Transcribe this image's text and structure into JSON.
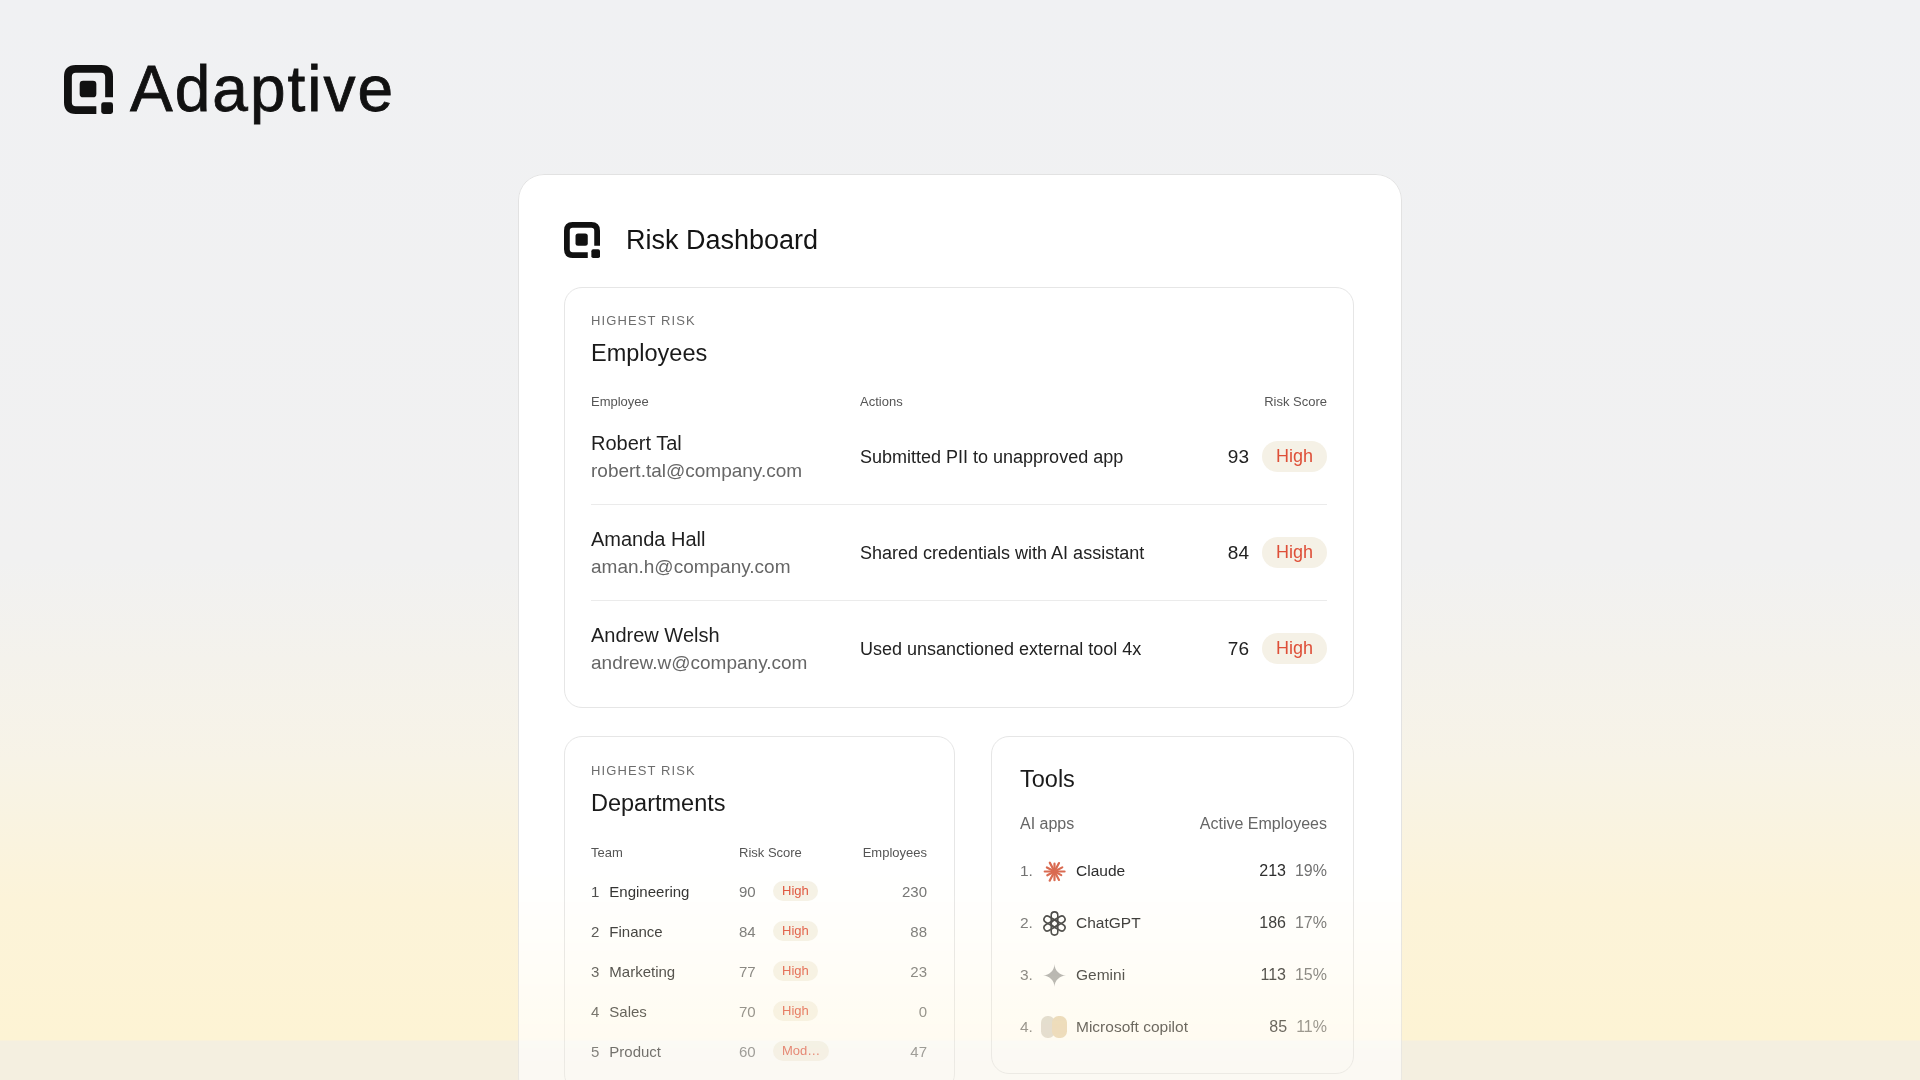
{
  "brand": {
    "name": "Adaptive"
  },
  "dashboard": {
    "title": "Risk Dashboard"
  },
  "employees_panel": {
    "eyebrow": "HIGHEST RISK",
    "title": "Employees",
    "columns": [
      "Employee",
      "Actions",
      "Risk Score"
    ],
    "rows": [
      {
        "name": "Robert Tal",
        "email": "robert.tal@company.com",
        "action": "Submitted PII to unapproved app",
        "score": "93",
        "risk": "High"
      },
      {
        "name": "Amanda Hall",
        "email": "aman.h@company.com",
        "action": "Shared credentials with AI assistant",
        "score": "84",
        "risk": "High"
      },
      {
        "name": "Andrew Welsh",
        "email": "andrew.w@company.com",
        "action": "Used unsanctioned external tool 4x",
        "score": "76",
        "risk": "High"
      }
    ]
  },
  "departments_panel": {
    "eyebrow": "HIGHEST RISK",
    "title": "Departments",
    "columns": [
      "Team",
      "Risk Score",
      "Employees"
    ],
    "rows": [
      {
        "rank": "1",
        "team": "Engineering",
        "score": "90",
        "risk": "High",
        "employees": "230"
      },
      {
        "rank": "2",
        "team": "Finance",
        "score": "84",
        "risk": "High",
        "employees": "88"
      },
      {
        "rank": "3",
        "team": "Marketing",
        "score": "77",
        "risk": "High",
        "employees": "23"
      },
      {
        "rank": "4",
        "team": "Sales",
        "score": "70",
        "risk": "High",
        "employees": "0"
      },
      {
        "rank": "5",
        "team": "Product",
        "score": "60",
        "risk": "Mod…",
        "employees": "47"
      }
    ]
  },
  "tools_panel": {
    "title": "Tools",
    "columns": [
      "AI apps",
      "Active Employees"
    ],
    "rows": [
      {
        "rank": "1.",
        "kind": "starburst",
        "name": "Claude",
        "count": "213",
        "share": "19%"
      },
      {
        "rank": "2.",
        "kind": "knot",
        "name": "ChatGPT",
        "count": "186",
        "share": "17%"
      },
      {
        "rank": "3.",
        "kind": "sparkle",
        "name": "Gemini",
        "count": "113",
        "share": "15%"
      },
      {
        "rank": "4.",
        "kind": "blob",
        "name": "Microsoft copilot",
        "count": "85",
        "share": "11%"
      }
    ]
  }
}
